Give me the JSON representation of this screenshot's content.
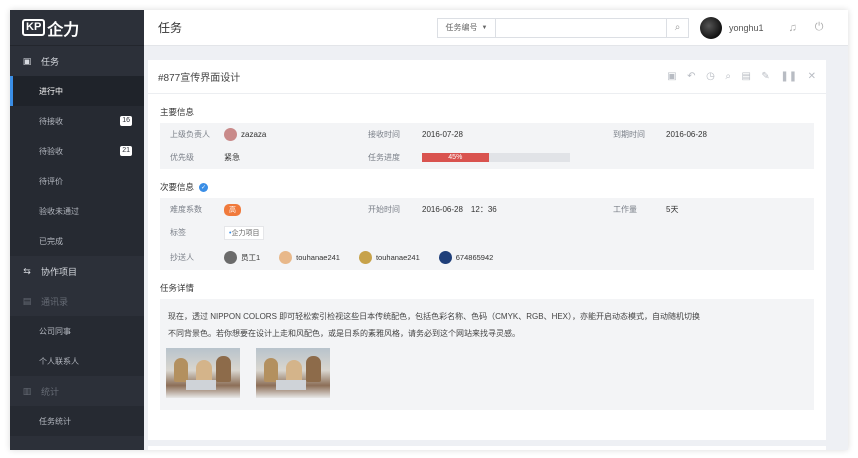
{
  "app": {
    "logo_mark": "KP",
    "logo_text": "企力"
  },
  "sidebar": {
    "groups": [
      {
        "label": "任务",
        "icon": "calendar-icon",
        "disabled": false
      },
      {
        "label": "协作项目",
        "icon": "swap-icon",
        "disabled": false
      },
      {
        "label": "通讯录",
        "icon": "list-icon",
        "disabled": true
      },
      {
        "label": "统计",
        "icon": "bar-chart-icon",
        "disabled": true
      }
    ],
    "task_items": [
      {
        "label": "进行中",
        "active": true
      },
      {
        "label": "待接收",
        "badge": "16"
      },
      {
        "label": "待验收",
        "badge": "21"
      },
      {
        "label": "待评价"
      },
      {
        "label": "验收未通过"
      },
      {
        "label": "已完成"
      }
    ],
    "contact_items": [
      {
        "label": "公司同事"
      },
      {
        "label": "个人联系人"
      }
    ],
    "stats_items": [
      {
        "label": "任务统计"
      }
    ]
  },
  "topbar": {
    "title": "任务",
    "search_select": "任务编号",
    "search_placeholder": "",
    "username": "yonghu1"
  },
  "task": {
    "title": "#877宣传界面设计",
    "main_section": "主要信息",
    "secondary_section": "次要信息",
    "detail_section": "任务详情",
    "fields": {
      "leader_label": "上级负责人",
      "leader_value": "zazaza",
      "receive_label": "接收时间",
      "receive_value": "2016-07-28",
      "due_label": "到期时间",
      "due_value": "2016-06-28",
      "priority_label": "优先级",
      "priority_value": "紧急",
      "progress_label": "任务进度",
      "progress_value": "45%",
      "progress_fraction": 0.45,
      "difficulty_label": "难度系数",
      "difficulty_value": "高",
      "start_label": "开始时间",
      "start_value": "2016-06-28　12：36",
      "workload_label": "工作量",
      "workload_value": "5天",
      "tags_label": "标签",
      "tag_value": "企力项目",
      "cc_label": "抄送人"
    },
    "cc": [
      {
        "name": "员工1",
        "color": "#6b6b6b"
      },
      {
        "name": "touhanae241",
        "color": "#e8b88a"
      },
      {
        "name": "touhanae241",
        "color": "#c7a24a"
      },
      {
        "name": "674865942",
        "color": "#1f3f7a"
      }
    ],
    "description_line1": "现在，透过 NIPPON COLORS 即可轻松索引检视这些日本传统配色，包括色彩名称、色码（CMYK、RGB、HEX），亦能开启动态模式，自动随机切换",
    "description_line2": "不同背景色。若你想要在设计上走和风配色，或是日系的素雅风格，请务必到这个网站来找寻灵感。"
  },
  "colors": {
    "accent": "#3a8ee6",
    "progress": "#d9534f",
    "high": "#f07a3c",
    "sidebar": "#2c3039"
  }
}
